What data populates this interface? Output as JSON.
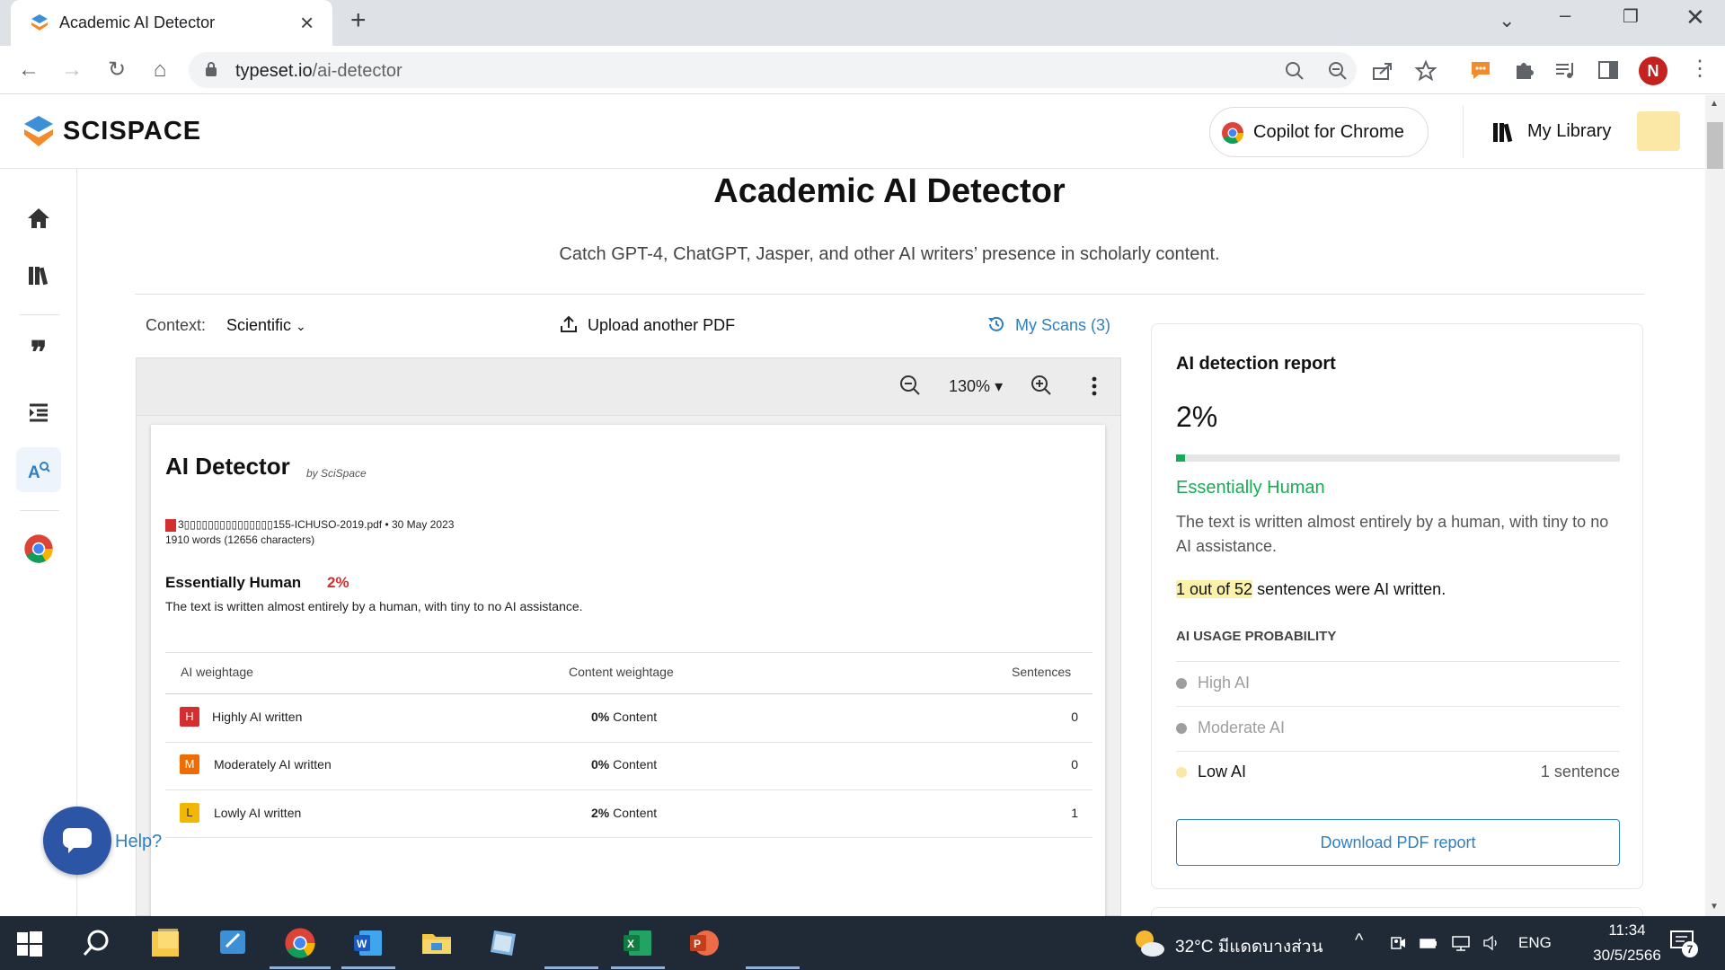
{
  "browser": {
    "tab_title": "Academic AI Detector",
    "url_host": "typeset.io",
    "url_path": "/ai-detector",
    "avatar_letter": "N"
  },
  "header": {
    "logo": "SCISPACE",
    "copilot_label": "Copilot for Chrome",
    "library_label": "My Library"
  },
  "main": {
    "title": "Academic AI Detector",
    "subtitle": "Catch GPT-4, ChatGPT, Jasper, and other AI writers’ presence in scholarly content.",
    "context_label": "Context:",
    "context_value": "Scientific",
    "upload_label": "Upload another PDF",
    "scans_label": "My Scans (3)"
  },
  "viewer": {
    "zoom": "130%",
    "zoom_caret": "▾",
    "doc": {
      "title": "AI Detector",
      "by": "by SciSpace",
      "file_line": "3▯▯▯▯▯▯▯▯▯▯▯▯▯▯▯155-ICHUSO-2019.pdf • 30 May 2023",
      "words_line": "1910 words (12656 characters)",
      "verdict": "Essentially Human",
      "verdict_pct": "2%",
      "verdict_desc": "The text is written almost entirely by a human, with tiny to no AI assistance.",
      "headers": [
        "AI weightage",
        "Content weightage",
        "Sentences"
      ],
      "rows": [
        {
          "badge": "H",
          "label": "Highly AI written",
          "pct": "0%",
          "pct_suffix": "Content",
          "count": "0",
          "color": "#d32f2f"
        },
        {
          "badge": "M",
          "label": "Moderately AI written",
          "pct": "0%",
          "pct_suffix": "Content",
          "count": "0",
          "color": "#ef6c00"
        },
        {
          "badge": "L",
          "label": "Lowly AI written",
          "pct": "2%",
          "pct_suffix": "Content",
          "count": "1",
          "color": "#f2b705"
        }
      ]
    }
  },
  "chat": {
    "help_label": "Help?"
  },
  "report": {
    "title": "AI detection report",
    "percent": "2%",
    "percent_value": 0.02,
    "verdict": "Essentially Human",
    "description": "The text is written almost entirely by a human, with tiny to no AI assistance.",
    "count_highlight": "1 out of 52",
    "count_suffix": "sentences were AI written.",
    "usage_heading": "AI USAGE PROBABILITY",
    "levels": [
      {
        "label": "High AI",
        "color": "#9e9e9e",
        "count": ""
      },
      {
        "label": "Moderate AI",
        "color": "#9e9e9e",
        "count": ""
      },
      {
        "label": "Low AI",
        "color": "#fbe7a6",
        "count": "1 sentence"
      }
    ],
    "download_label": "Download PDF report"
  },
  "taskbar": {
    "weather": "32°C  มีแดดบางส่วน",
    "lang": "ENG",
    "time": "11:34",
    "date": "30/5/2566",
    "notif_count": "7"
  },
  "colors": {
    "accent": "#2f7fc1",
    "human_green": "#1aaa55",
    "taskbar": "#1f2a36"
  }
}
